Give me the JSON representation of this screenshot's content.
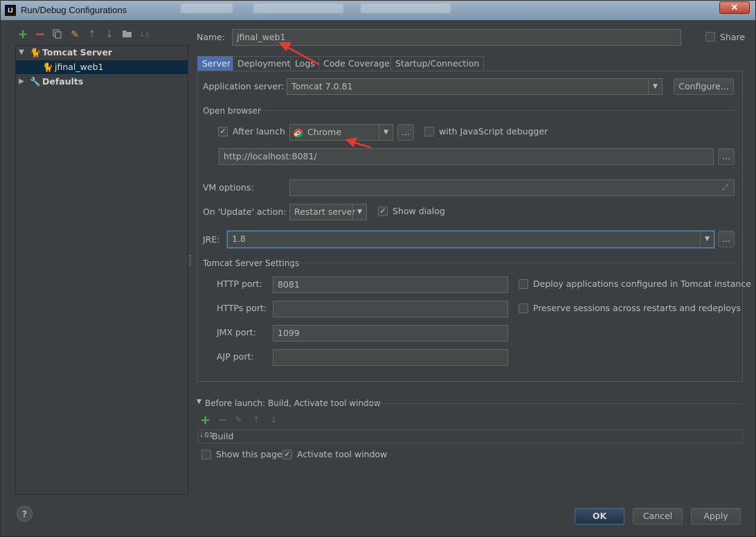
{
  "window": {
    "title": "Run/Debug Configurations",
    "app_icon": "IJ",
    "close": "✕"
  },
  "toolbar": {
    "icons": [
      "add-icon",
      "remove-icon",
      "copy-icon",
      "edit-defaults-icon",
      "move-up-icon",
      "move-down-icon",
      "folder-icon",
      "sort-icon"
    ]
  },
  "tree": {
    "tomcat": {
      "label": "Tomcat Server"
    },
    "config": {
      "label": "jfinal_web1"
    },
    "defaults": {
      "label": "Defaults"
    }
  },
  "name": {
    "label": "Name:",
    "value": "jfinal_web1"
  },
  "share": {
    "label": "Share",
    "checked": false
  },
  "tabs": [
    "Server",
    "Deployment",
    "Logs",
    "Code Coverage",
    "Startup/Connection"
  ],
  "server": {
    "app_server_label": "Application server:",
    "app_server_value": "Tomcat 7.0.81",
    "configure": "Configure...",
    "open_browser": "Open browser",
    "after_launch": {
      "label": "After launch",
      "checked": true
    },
    "browser": "Chrome",
    "dots": "...",
    "js_debugger": {
      "label": "with JavaScript debugger",
      "checked": false
    },
    "url": "http://localhost:8081/",
    "vm_label": "VM options:",
    "vm_value": "",
    "update_label": "On 'Update' action:",
    "update_value": "Restart server",
    "show_dialog": {
      "label": "Show dialog",
      "checked": true
    },
    "jre_label": "JRE:",
    "jre_value": "1.8",
    "tomcat_settings": "Tomcat Server Settings",
    "http_label": "HTTP port:",
    "http_value": "8081",
    "https_label": "HTTPs port:",
    "https_value": "",
    "jmx_label": "JMX port:",
    "jmx_value": "1099",
    "ajp_label": "AJP port:",
    "ajp_value": "",
    "deploy_cfg": {
      "label": "Deploy applications configured in Tomcat instance",
      "checked": false
    },
    "preserve": {
      "label": "Preserve sessions across restarts and redeploys",
      "checked": false
    }
  },
  "before_launch": {
    "header": "Before launch: Build, Activate tool window",
    "item": "Build",
    "show_page": {
      "label": "Show this page",
      "checked": false
    },
    "activate": {
      "label": "Activate tool window",
      "checked": true
    }
  },
  "buttons": {
    "help": "?",
    "ok": "OK",
    "cancel": "Cancel",
    "apply": "Apply"
  },
  "colors": {
    "bg": "#3c3f41",
    "accent": "#4b6eaf",
    "selection": "#0d293e",
    "annotation": "#e53935"
  }
}
